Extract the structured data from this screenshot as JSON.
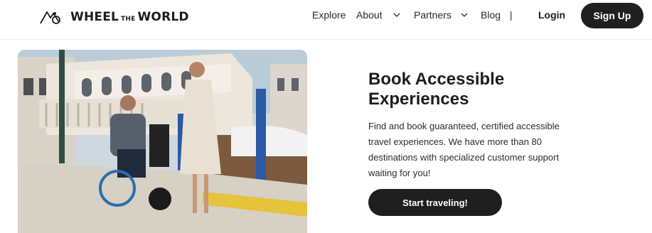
{
  "header": {
    "logo_text_1": "WHEEL",
    "logo_text_2": "THE",
    "logo_text_3": "WORLD",
    "nav": {
      "explore": "Explore",
      "about": "About",
      "partners": "Partners",
      "blog": "Blog",
      "separator": "|"
    },
    "login_label": "Login",
    "signup_label": "Sign Up"
  },
  "hero": {
    "title": "Book Accessible Experiences",
    "description": "Find and book guaranteed, certified accessible travel experiences. We have more than 80 destinations with specialized customer support waiting for you!",
    "cta_label": "Start traveling!"
  },
  "colors": {
    "primary_dark": "#1f1f1f",
    "background": "#ffffff"
  }
}
